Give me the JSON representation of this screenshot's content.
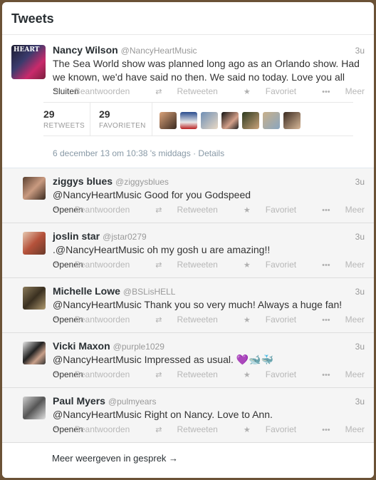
{
  "header": {
    "title": "Tweets"
  },
  "main_tweet": {
    "name": "Nancy Wilson",
    "handle": "@NancyHeartMusic",
    "time": "3u",
    "text": "The Sea World show was planned long ago as an Orlando show. Had we known, we'd have said no then. We said no today. Love you all",
    "collapse": "Sluiten",
    "retweets_count": "29",
    "retweets_label": "RETWEETS",
    "favorites_count": "29",
    "favorites_label": "FAVORIETEN",
    "date": "6 december 13 om 10:38 's middags · Details"
  },
  "actions": {
    "reply": "Beantwoorden",
    "retweet": "Retweeten",
    "favorite": "Favoriet",
    "more": "Meer"
  },
  "replies": [
    {
      "name": "ziggys blues",
      "handle": "@ziggysblues",
      "time": "3u",
      "text": "@NancyHeartMusic Good for you  Godspeed",
      "open": "Openen"
    },
    {
      "name": "joslin star",
      "handle": "@jstar0279",
      "time": "3u",
      "text": ".@NancyHeartMusic oh my gosh u are amazing!!",
      "open": "Openen"
    },
    {
      "name": "Michelle Lowe",
      "handle": "@BSLisHELL",
      "time": "3u",
      "text": "@NancyHeartMusic  Thank you so very much! Always a huge fan!",
      "open": "Openen"
    },
    {
      "name": "Vicki Maxon",
      "handle": "@purple1029",
      "time": "3u",
      "text": "@NancyHeartMusic  Impressed as usual. 💜🐋🐳",
      "open": "Openen"
    },
    {
      "name": "Paul Myers",
      "handle": "@pulmyears",
      "time": "3u",
      "text": "@NancyHeartMusic Right on Nancy. Love to Ann.",
      "open": "Openen"
    }
  ],
  "footer": {
    "more_link": "Meer weergeven in gesprek →"
  },
  "icons": {
    "reply": "reply-arrow-icon",
    "retweet": "retweet-icon",
    "favorite": "star-icon",
    "more": "ellipsis-icon"
  }
}
